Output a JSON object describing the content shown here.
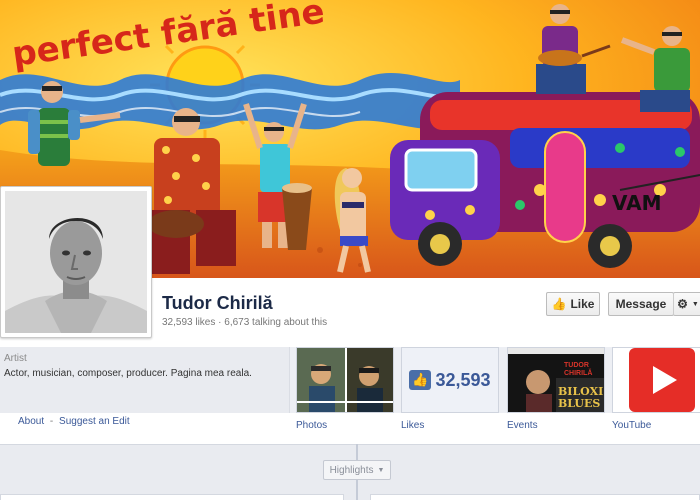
{
  "cover": {
    "title_text": "perfect fără tine"
  },
  "page": {
    "name": "Tudor Chirilă",
    "stats": "32,593 likes · 6,673 talking about this"
  },
  "actions": {
    "like_label": "Like",
    "message_label": "Message"
  },
  "about": {
    "category": "Artist",
    "description": "Actor, musician, composer, producer. Pagina mea reala.",
    "about_link": "About",
    "separator": "-",
    "suggest_link": "Suggest an Edit"
  },
  "apps": [
    {
      "label": "Photos"
    },
    {
      "label": "Likes",
      "count": "32,593"
    },
    {
      "label": "Events",
      "poster_top": "TUDOR CHIRILĂ",
      "poster_title": "BILOXI BLUES"
    },
    {
      "label": "YouTube"
    }
  ],
  "timeline": {
    "highlights_label": "Highlights"
  },
  "colors": {
    "facebook_blue": "#3b5998",
    "name_color": "#1c2a47",
    "youtube_red": "#e52d27"
  }
}
